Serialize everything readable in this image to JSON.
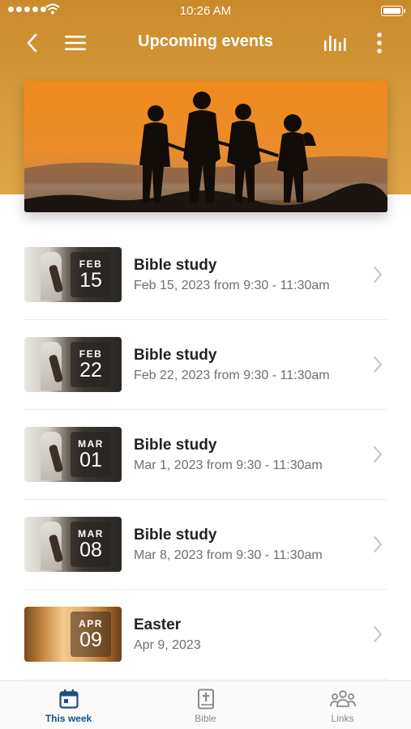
{
  "status_bar": {
    "time": "10:26 AM"
  },
  "header": {
    "title": "Upcoming events"
  },
  "events": [
    {
      "month": "FEB",
      "day": "15",
      "title": "Bible study",
      "subtitle": "Feb 15, 2023 from 9:30 - 11:30am",
      "thumb": "bible-study"
    },
    {
      "month": "FEB",
      "day": "22",
      "title": "Bible study",
      "subtitle": "Feb 22, 2023 from 9:30 - 11:30am",
      "thumb": "bible-study"
    },
    {
      "month": "MAR",
      "day": "01",
      "title": "Bible study",
      "subtitle": "Mar 1, 2023 from 9:30 - 11:30am",
      "thumb": "bible-study"
    },
    {
      "month": "MAR",
      "day": "08",
      "title": "Bible study",
      "subtitle": "Mar 8, 2023 from 9:30 - 11:30am",
      "thumb": "bible-study"
    },
    {
      "month": "APR",
      "day": "09",
      "title": "Easter",
      "subtitle": "Apr 9, 2023",
      "thumb": "easter"
    }
  ],
  "tabs": [
    {
      "label": "This week",
      "icon": "calendar-icon",
      "active": true
    },
    {
      "label": "Bible",
      "icon": "bible-icon",
      "active": false
    },
    {
      "label": "Links",
      "icon": "people-icon",
      "active": false
    }
  ],
  "colors": {
    "header": "#d79c3b",
    "active_tab": "#1d4f7d"
  }
}
